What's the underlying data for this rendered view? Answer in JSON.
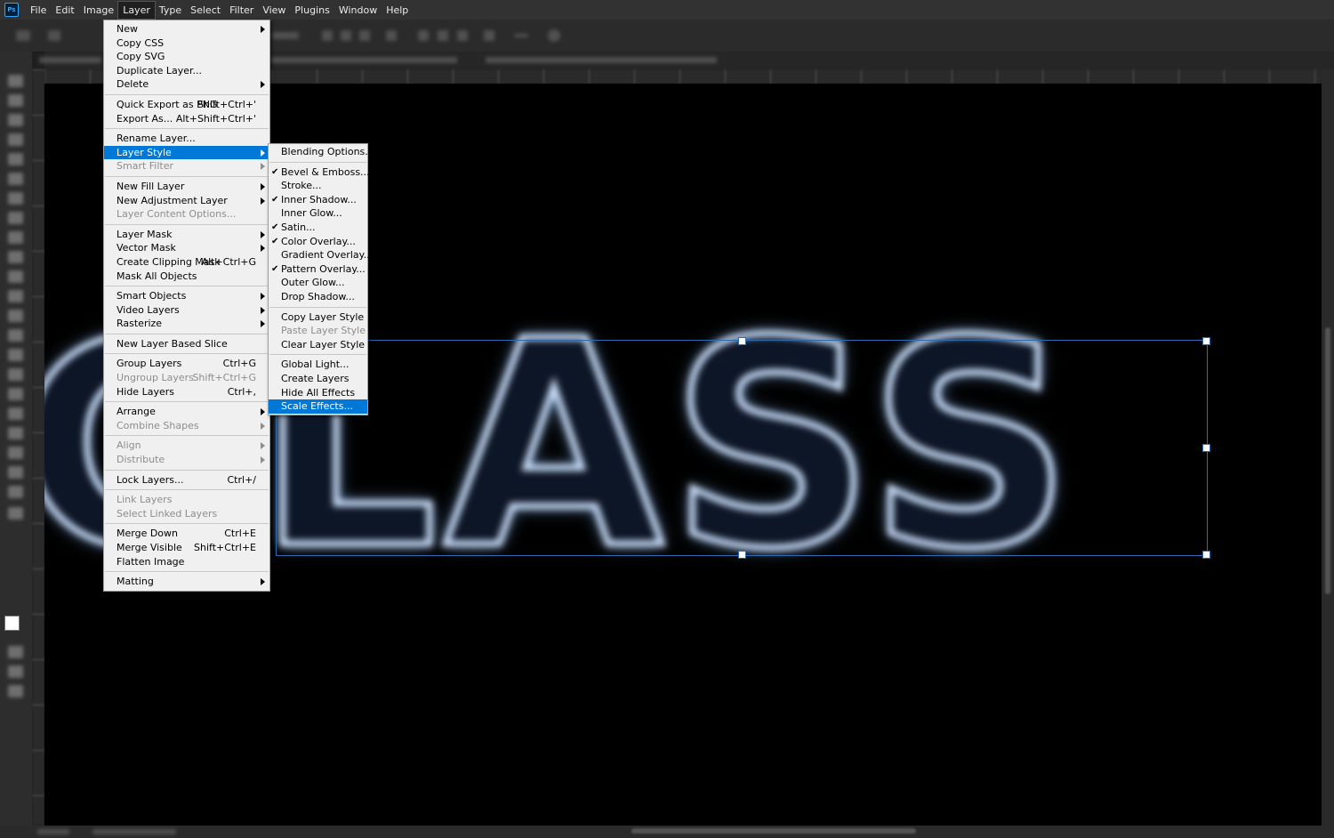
{
  "app": {
    "logo_text": "Ps",
    "accent": "#31a8ff",
    "highlight": "#0078d7"
  },
  "menubar": [
    "File",
    "Edit",
    "Image",
    "Layer",
    "Type",
    "Select",
    "Filter",
    "View",
    "Plugins",
    "Window",
    "Help"
  ],
  "active_menu": "Layer",
  "canvas": {
    "text": "GLASS"
  },
  "layer_menu": [
    {
      "label": "New",
      "submenu": true
    },
    {
      "label": "Copy CSS"
    },
    {
      "label": "Copy SVG"
    },
    {
      "label": "Duplicate Layer..."
    },
    {
      "label": "Delete",
      "submenu": true
    },
    {
      "sep": true
    },
    {
      "label": "Quick Export as PNG",
      "shortcut": "Shift+Ctrl+'"
    },
    {
      "label": "Export As...",
      "shortcut": "Alt+Shift+Ctrl+'"
    },
    {
      "sep": true
    },
    {
      "label": "Rename Layer..."
    },
    {
      "label": "Layer Style",
      "submenu": true,
      "highlighted": true
    },
    {
      "label": "Smart Filter",
      "submenu": true,
      "disabled": true
    },
    {
      "sep": true
    },
    {
      "label": "New Fill Layer",
      "submenu": true
    },
    {
      "label": "New Adjustment Layer",
      "submenu": true
    },
    {
      "label": "Layer Content Options...",
      "disabled": true
    },
    {
      "sep": true
    },
    {
      "label": "Layer Mask",
      "submenu": true
    },
    {
      "label": "Vector Mask",
      "submenu": true
    },
    {
      "label": "Create Clipping Mask",
      "shortcut": "Alt+Ctrl+G"
    },
    {
      "label": "Mask All Objects"
    },
    {
      "sep": true
    },
    {
      "label": "Smart Objects",
      "submenu": true
    },
    {
      "label": "Video Layers",
      "submenu": true
    },
    {
      "label": "Rasterize",
      "submenu": true
    },
    {
      "sep": true
    },
    {
      "label": "New Layer Based Slice"
    },
    {
      "sep": true
    },
    {
      "label": "Group Layers",
      "shortcut": "Ctrl+G"
    },
    {
      "label": "Ungroup Layers",
      "shortcut": "Shift+Ctrl+G",
      "disabled": true
    },
    {
      "label": "Hide Layers",
      "shortcut": "Ctrl+,"
    },
    {
      "sep": true
    },
    {
      "label": "Arrange",
      "submenu": true
    },
    {
      "label": "Combine Shapes",
      "submenu": true,
      "disabled": true
    },
    {
      "sep": true
    },
    {
      "label": "Align",
      "submenu": true,
      "disabled": true
    },
    {
      "label": "Distribute",
      "submenu": true,
      "disabled": true
    },
    {
      "sep": true
    },
    {
      "label": "Lock Layers...",
      "shortcut": "Ctrl+/"
    },
    {
      "sep": true
    },
    {
      "label": "Link Layers",
      "disabled": true
    },
    {
      "label": "Select Linked Layers",
      "disabled": true
    },
    {
      "sep": true
    },
    {
      "label": "Merge Down",
      "shortcut": "Ctrl+E"
    },
    {
      "label": "Merge Visible",
      "shortcut": "Shift+Ctrl+E"
    },
    {
      "label": "Flatten Image"
    },
    {
      "sep": true
    },
    {
      "label": "Matting",
      "submenu": true
    }
  ],
  "layer_style_menu": [
    {
      "label": "Blending Options..."
    },
    {
      "sep": true
    },
    {
      "label": "Bevel & Emboss...",
      "checked": true
    },
    {
      "label": "Stroke..."
    },
    {
      "label": "Inner Shadow...",
      "checked": true
    },
    {
      "label": "Inner Glow..."
    },
    {
      "label": "Satin...",
      "checked": true
    },
    {
      "label": "Color Overlay...",
      "checked": true
    },
    {
      "label": "Gradient Overlay..."
    },
    {
      "label": "Pattern Overlay...",
      "checked": true
    },
    {
      "label": "Outer Glow..."
    },
    {
      "label": "Drop Shadow..."
    },
    {
      "sep": true
    },
    {
      "label": "Copy Layer Style"
    },
    {
      "label": "Paste Layer Style",
      "disabled": true
    },
    {
      "label": "Clear Layer Style"
    },
    {
      "sep": true
    },
    {
      "label": "Global Light..."
    },
    {
      "label": "Create Layers"
    },
    {
      "label": "Hide All Effects"
    },
    {
      "label": "Scale Effects...",
      "highlighted": true
    }
  ]
}
